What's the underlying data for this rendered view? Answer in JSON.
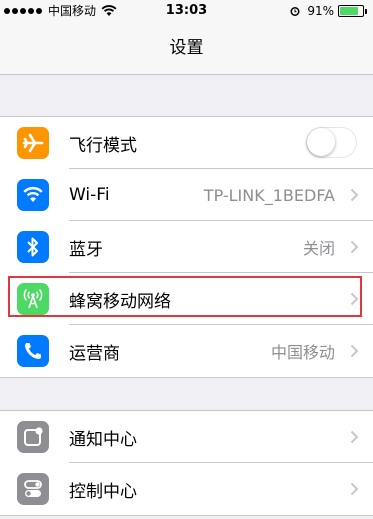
{
  "status_bar": {
    "carrier": "中国移动",
    "time": "13:03",
    "battery_percent": "91%",
    "battery_level": 0.91,
    "signal_dots": 5
  },
  "nav": {
    "title": "设置"
  },
  "groups": [
    {
      "rows": [
        {
          "label": "飞行模式",
          "icon": "airplane-icon",
          "icon_color": "#ff9500",
          "control": "toggle",
          "toggle_on": false
        },
        {
          "label": "Wi-Fi",
          "icon": "wifi-icon",
          "icon_color": "#007aff",
          "value": "TP-LINK_1BEDFA"
        },
        {
          "label": "蓝牙",
          "icon": "bluetooth-icon",
          "icon_color": "#007aff",
          "value": "关闭"
        },
        {
          "label": "蜂窝移动网络",
          "icon": "cellular-antenna-icon",
          "icon_color": "#4cd964",
          "highlighted": true
        },
        {
          "label": "运营商",
          "icon": "phone-icon",
          "icon_color": "#007aff",
          "value": "中国移动"
        }
      ]
    },
    {
      "rows": [
        {
          "label": "通知中心",
          "icon": "notification-center-icon",
          "icon_color": "#8e8e93"
        },
        {
          "label": "控制中心",
          "icon": "control-center-icon",
          "icon_color": "#8e8e93"
        }
      ]
    }
  ],
  "colors": {
    "highlight_border": "#e0383e",
    "background": "#efeff4",
    "secondary_text": "#8e8e93"
  }
}
